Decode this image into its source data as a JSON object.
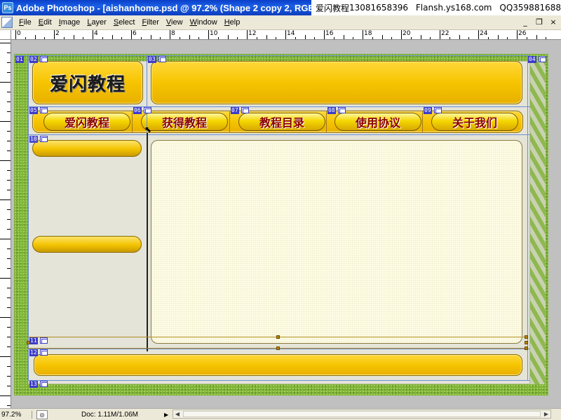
{
  "titlebar": {
    "title": "Adobe Photoshop - [aishanhome.psd @ 97.2% (Shape 2 copy 2, RGB/",
    "overlay_brand": "爱闪教程",
    "overlay_phone": "13081658396",
    "overlay_site": "Flansh.ys168.com",
    "overlay_qq": "QQ359881688"
  },
  "menubar": {
    "items": [
      "File",
      "Edit",
      "Image",
      "Layer",
      "Select",
      "Filter",
      "View",
      "Window",
      "Help"
    ],
    "window_controls": [
      "_",
      "❐",
      "×"
    ]
  },
  "ruler": {
    "labels": [
      "0",
      "2",
      "4",
      "6",
      "8",
      "10",
      "12",
      "14",
      "16",
      "18",
      "20",
      "22",
      "24",
      "26"
    ]
  },
  "document": {
    "logo_text": "爱闪教程",
    "nav": [
      "爱闪教程",
      "获得教程",
      "教程目录",
      "使用协议",
      "关于我们"
    ],
    "slices": [
      "01",
      "02",
      "03",
      "04",
      "05",
      "06",
      "07",
      "08",
      "09",
      "10",
      "11",
      "12",
      "13"
    ]
  },
  "statusbar": {
    "zoom": "97.2%",
    "doc_info": "Doc: 1.11M/1.06M"
  },
  "colors": {
    "titlebar": "#0a3fc8",
    "gold": "#f6c400",
    "nav_text": "#8a0000",
    "background_green": "#7fb23a",
    "slice_tag": "#3c3cc8"
  }
}
